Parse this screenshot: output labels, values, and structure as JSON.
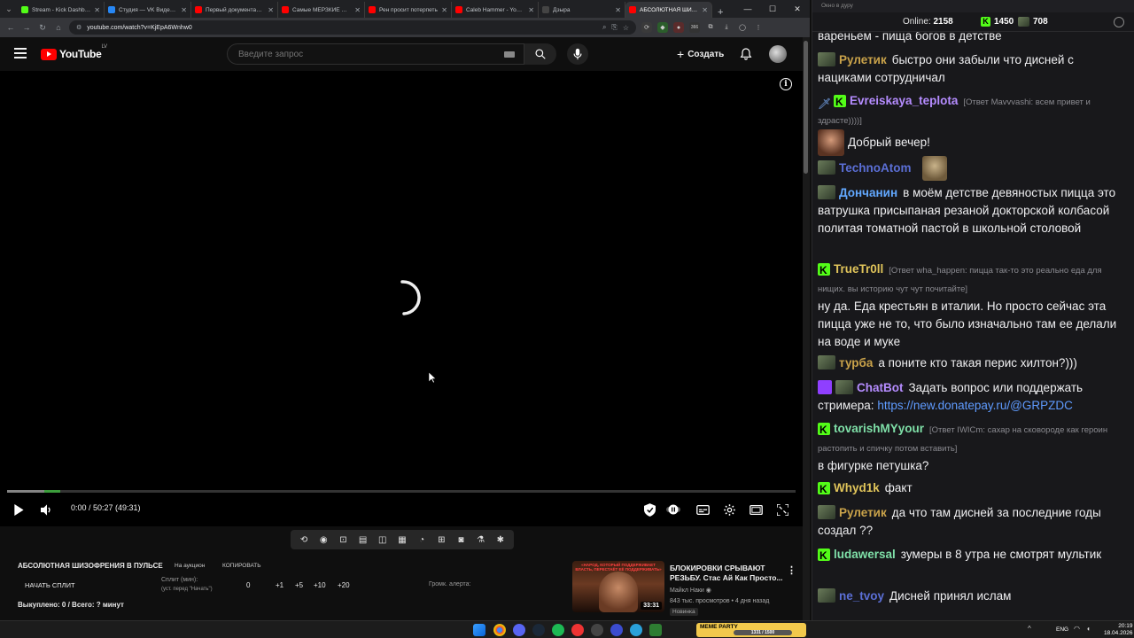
{
  "browser": {
    "tabs": [
      {
        "title": "Stream - Kick Dashboar",
        "fav": "#53fc18",
        "active": false
      },
      {
        "title": "Студия — VK Видео Li...",
        "fav": "#2787f5",
        "active": false
      },
      {
        "title": "Первый документальн",
        "fav": "#ff0000",
        "active": false
      },
      {
        "title": "Самые МЕРЗКИЕ фору",
        "fav": "#ff0000",
        "active": false
      },
      {
        "title": "Рен просит потерпеть",
        "fav": "#ff0000",
        "active": false
      },
      {
        "title": "Caleb Hammer - YouT...",
        "fav": "#ff0000",
        "active": false
      },
      {
        "title": "Дзыра",
        "fav": "#444444",
        "active": false
      },
      {
        "title": "АБСОЛЮТНАЯ ШИЗО",
        "fav": "#ff0000",
        "active": true
      }
    ],
    "url": "youtube.com/watch?v=KjEpA6Wnhw0",
    "ext_badge": "366"
  },
  "youtube": {
    "logo_text": "YouTube",
    "logo_region": "LV",
    "search_placeholder": "Введите запрос",
    "create_label": "Создать",
    "player": {
      "time": "0:00 / 50:27 (49:31)",
      "buffered_fraction": 0.065,
      "loop_segment_start_fraction": 0.047,
      "loop_segment_end_fraction": 0.067
    },
    "bottom_panel": {
      "title": "АБСОЛЮТНАЯ ШИЗОФРЕНИЯ В ПУЛЬСЕ",
      "auction_label": "На аукцион",
      "copy_label": "КОПИРОВАТЬ",
      "start_split_label": "НАЧАТЬ СПЛИТ",
      "split_label": "Сплит (мин):",
      "split_hint": "(уст. перед \"Начать\")",
      "split_value": "0",
      "increments": [
        "+1",
        "+5",
        "+10",
        "+20"
      ],
      "alert_label": "Громк. алерта:",
      "bought_label": "Выкуплено: 0 / Всего: ? минут"
    },
    "recommendation": {
      "thumb_banner": "«НАРОД, КОТОРЫЙ ПОДДЕРЖИВАЕТ ВЛАСТЬ, ПЕРЕСТАЁТ ЕЁ ПОДДЕРЖИВАТЬ»",
      "duration": "33:31",
      "title": "БЛОКИРОВКИ СРЫВАЮТ РЕЗЬБУ. Стас Ай Как Просто...",
      "channel": "Майкл Наки",
      "meta": "843 тыс. просмотров • 4 дня назад",
      "badge": "Новинка"
    }
  },
  "chat": {
    "window_title": "Окно в дуру",
    "online_label": "Online:",
    "online_count": "2158",
    "count_kick": "1450",
    "count_other": "708",
    "messages": [
      {
        "user": "",
        "color": "#efeff1",
        "text": "вареньем - пища богов в детстве",
        "reply": ""
      },
      {
        "user": "Рулетик",
        "color": "#c9a24a",
        "text": "быстро они забыли что дисней с нациками сотрудничал",
        "reply": ""
      },
      {
        "user": "Evreiskaya_teplota",
        "color": "#b58cff",
        "text": "Добрый вечер!",
        "reply": "[Ответ Mavvvashi: всем привет и здрасте))))]"
      },
      {
        "user": "TechnoAtom",
        "color": "#5b6fd6",
        "text": "",
        "reply": ""
      },
      {
        "user": "Дончанин",
        "color": "#62a8ff",
        "text": "в моём детстве девяностых пицца это ватрушка присыпаная резаной докторской колбасой политая томатной пастой в школьной столовой",
        "reply": ""
      },
      {
        "user": "TrueTr0ll",
        "color": "#e0c45a",
        "text": "ну да. Еда крестьян в италии. Но просто сейчас эта пицца уже не то, что было изначально там ее делали на воде и муке",
        "reply": "[Ответ wha_happen: пицца так-то это реально еда для нищих. вы историю чут чут почитайте]"
      },
      {
        "user": "турба",
        "color": "#c9a24a",
        "text": "а поните кто такая перис хилтон?)))",
        "reply": ""
      },
      {
        "user": "ChatBot",
        "color": "#b58cff",
        "text": "Задать вопрос или поддержать стримера:",
        "link": "https://new.donatepay.ru/@GRPZDC",
        "reply": ""
      },
      {
        "user": "tovarishMYyour",
        "color": "#7fe0a8",
        "text": "в фигурке петушка?",
        "reply": "[Ответ IWICm: сахар на сковороде как героин растопить и спичку потом вставить]"
      },
      {
        "user": "Whyd1k",
        "color": "#e0c45a",
        "text": "факт",
        "reply": ""
      },
      {
        "user": "Рулетик",
        "color": "#c9a24a",
        "text": "да что там дисней за последние годы создал ??",
        "reply": ""
      },
      {
        "user": "ludawersal",
        "color": "#7fe0a8",
        "text": "зумеры в 8 утра не смотрят мультик",
        "reply": ""
      },
      {
        "user": "ne_tvoy",
        "color": "#5b6fd6",
        "text": "Дисней принял ислам",
        "reply": ""
      }
    ]
  },
  "taskbar": {
    "meme_label": "MEME PARTY",
    "meme_progress": "1331 / 1500",
    "lang": "ENG",
    "time": "20:19",
    "date": "18.04.2026"
  }
}
